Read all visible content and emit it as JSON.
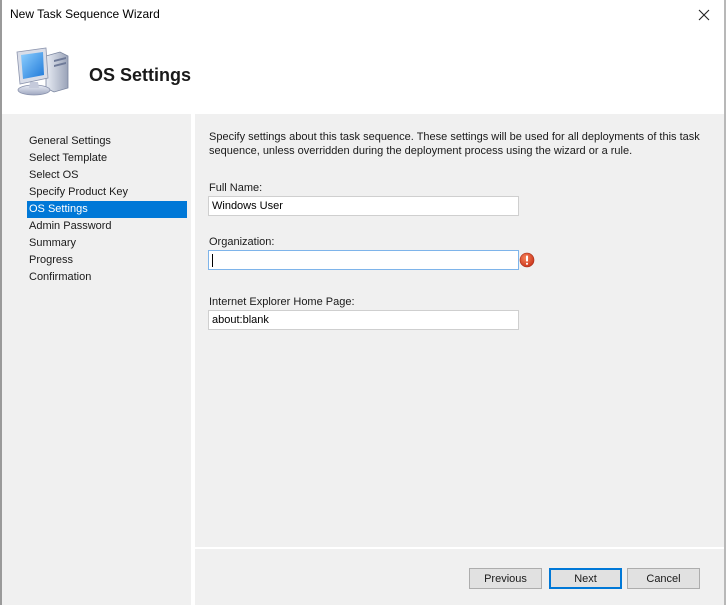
{
  "window": {
    "title": "New Task Sequence Wizard",
    "close_icon": "close-icon"
  },
  "header": {
    "icon": "computer-icon",
    "title": "OS Settings"
  },
  "sidebar": {
    "items": [
      {
        "label": "General Settings",
        "selected": false
      },
      {
        "label": "Select Template",
        "selected": false
      },
      {
        "label": "Select OS",
        "selected": false
      },
      {
        "label": "Specify Product Key",
        "selected": false
      },
      {
        "label": "OS Settings",
        "selected": true
      },
      {
        "label": "Admin Password",
        "selected": false
      },
      {
        "label": "Summary",
        "selected": false
      },
      {
        "label": "Progress",
        "selected": false
      },
      {
        "label": "Confirmation",
        "selected": false
      }
    ],
    "selected_color": "#0078d7"
  },
  "main": {
    "description": "Specify settings about this task sequence.  These settings will be used for all deployments of this task sequence, unless overridden during the deployment process using the wizard or a rule.",
    "fields": {
      "full_name": {
        "label": "Full Name:",
        "value": "Windows User"
      },
      "organization": {
        "label": "Organization:",
        "value": "",
        "focused": true,
        "error_icon": "error-icon",
        "error_color": "#d9412a"
      },
      "ie_home_page": {
        "label": "Internet Explorer Home Page:",
        "value": "about:blank"
      }
    }
  },
  "footer": {
    "previous_label": "Previous",
    "next_label": "Next",
    "cancel_label": "Cancel"
  }
}
